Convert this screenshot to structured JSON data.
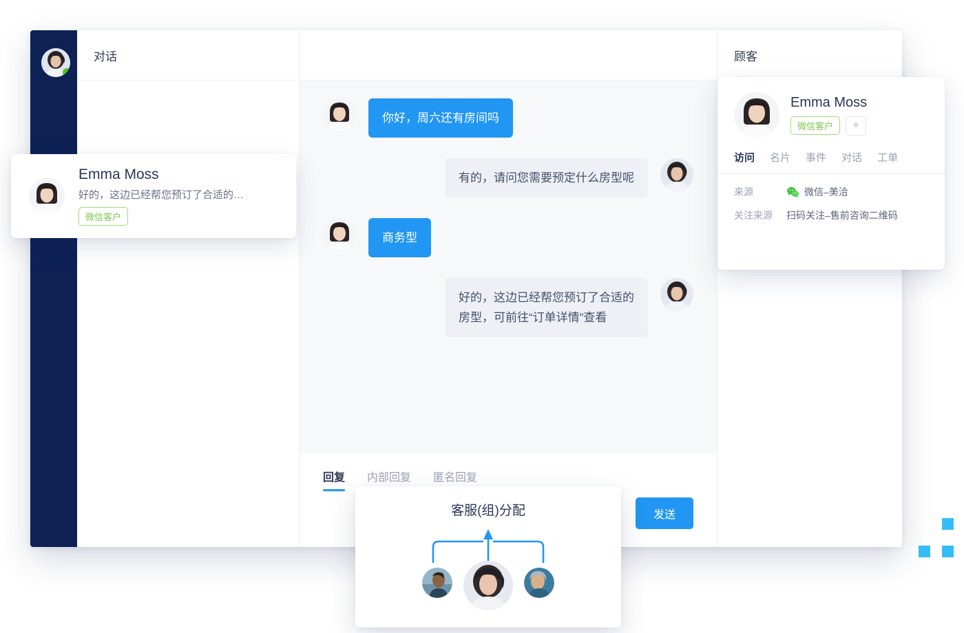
{
  "window": {
    "conversation_column_title": "对话",
    "customer_column_title": "顾客"
  },
  "rail": {
    "avatar_name": "agent-avatar",
    "status": "online"
  },
  "conversation_card": {
    "name": "Emma Moss",
    "preview": "好的，这边已经帮您预订了合适的…",
    "tag": "微信客户"
  },
  "chat": {
    "messages": [
      {
        "side": "in",
        "text": "你好，周六还有房间吗"
      },
      {
        "side": "out",
        "text": "有的，请问您需要预定什么房型呢"
      },
      {
        "side": "in",
        "text": "商务型"
      },
      {
        "side": "out",
        "text": "好的，这边已经帮您预订了合适的\n房型，可前往“订单详情”查看"
      }
    ]
  },
  "composer": {
    "tabs": [
      {
        "label": "回复",
        "active": true
      },
      {
        "label": "内部回复",
        "active": false
      },
      {
        "label": "匿名回复",
        "active": false
      }
    ],
    "send_label": "发送"
  },
  "customer_card": {
    "name": "Emma Moss",
    "tag": "微信客户",
    "add_tag_label": "+",
    "tabs": [
      {
        "label": "访问",
        "active": true
      },
      {
        "label": "名片",
        "active": false
      },
      {
        "label": "事件",
        "active": false
      },
      {
        "label": "对话",
        "active": false
      },
      {
        "label": "工单",
        "active": false
      }
    ],
    "fields": [
      {
        "label": "来源",
        "value": "微信–美洽",
        "icon": "wechat-icon"
      },
      {
        "label": "关注来源",
        "value": "扫码关注–售前咨询二维码",
        "icon": null
      }
    ]
  },
  "assign_card": {
    "title": "客服(组)分配"
  },
  "colors": {
    "accent_blue": "#2196f3",
    "navy": "#0d2155",
    "tag_green": "#7ec94f",
    "status_green": "#52c41a",
    "deco_blue": "#35bdf8",
    "chat_bg": "#f7f8fa",
    "bubble_in": "#2196f3",
    "bubble_out": "#eef0f5"
  }
}
